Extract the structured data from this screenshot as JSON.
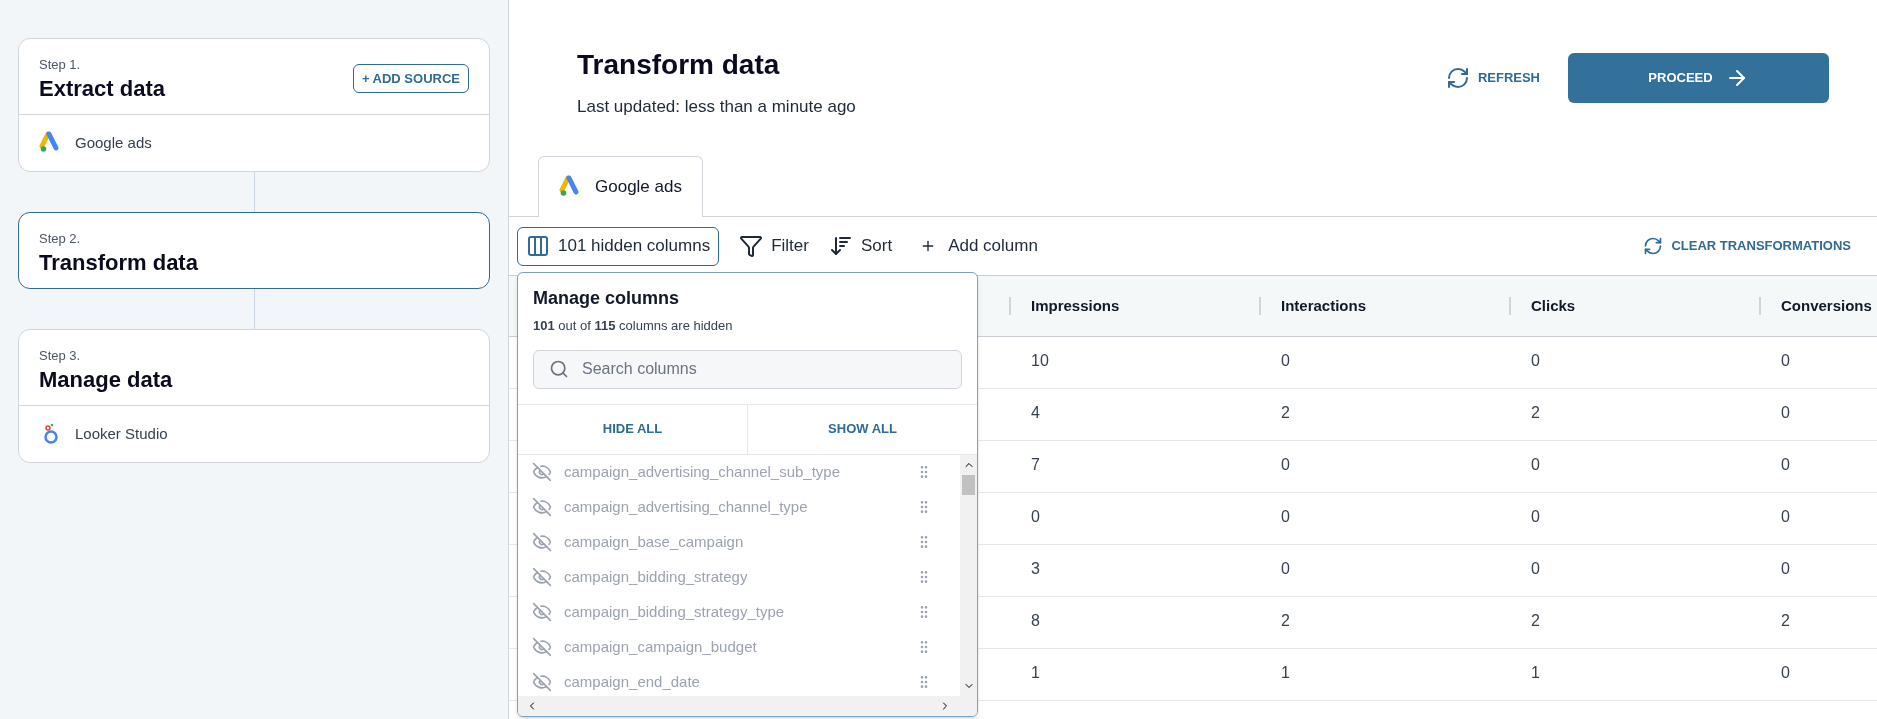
{
  "steps": [
    {
      "step": "Step 1.",
      "title": "Extract data",
      "selected": false,
      "button": "+ ADD SOURCE",
      "item": {
        "kind": "ads",
        "label": "Google ads"
      }
    },
    {
      "step": "Step 2.",
      "title": "Transform data",
      "selected": true
    },
    {
      "step": "Step 3.",
      "title": "Manage data",
      "selected": false,
      "item": {
        "kind": "looker",
        "label": "Looker Studio"
      }
    }
  ],
  "header": {
    "title": "Transform data",
    "subtitle": "Last updated: less than a minute ago",
    "refresh": "REFRESH",
    "proceed": "PROCEED"
  },
  "tabs": [
    {
      "label": "Google ads",
      "selected": true
    }
  ],
  "toolbar": {
    "hidden_columns": "101 hidden columns",
    "filter": "Filter",
    "sort": "Sort",
    "add_column": "Add column",
    "clear": "CLEAR TRANSFORMATIONS"
  },
  "manage_columns": {
    "title": "Manage columns",
    "summary": "**101** out of **115** columns are hidden",
    "placeholder": "Search columns",
    "hide_all": "HIDE ALL",
    "show_all": "SHOW ALL",
    "columns": [
      {
        "name": "campaign_advertising_channel_sub_type",
        "visible": false
      },
      {
        "name": "campaign_advertising_channel_type",
        "visible": false
      },
      {
        "name": "campaign_base_campaign",
        "visible": false
      },
      {
        "name": "campaign_bidding_strategy",
        "visible": false
      },
      {
        "name": "campaign_bidding_strategy_type",
        "visible": false
      },
      {
        "name": "campaign_campaign_budget",
        "visible": false
      },
      {
        "name": "campaign_end_date",
        "visible": false
      }
    ]
  },
  "table": {
    "columns": [
      "Impressions",
      "Interactions",
      "Clicks",
      "Conversions"
    ],
    "rows": [
      [
        "10",
        "0",
        "0",
        "0"
      ],
      [
        "4",
        "2",
        "2",
        "0"
      ],
      [
        "7",
        "0",
        "0",
        "0"
      ],
      [
        "0",
        "0",
        "0",
        "0"
      ],
      [
        "3",
        "0",
        "0",
        "0"
      ],
      [
        "8",
        "2",
        "2",
        "2"
      ],
      [
        "1",
        "1",
        "1",
        "0"
      ]
    ]
  }
}
